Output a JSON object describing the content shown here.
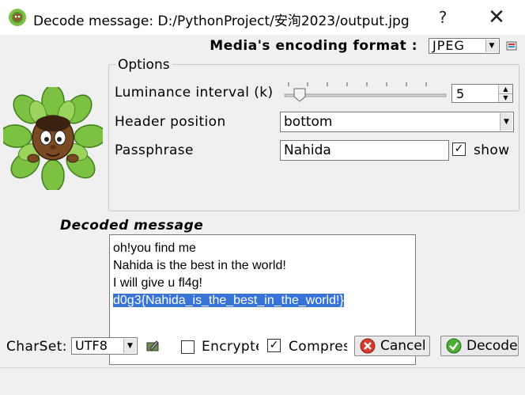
{
  "window": {
    "title": "Decode message: D:/PythonProject/安洵2023/output.jpg",
    "help_label": "?",
    "close_label": "✕"
  },
  "format": {
    "label": "Media's encoding format :",
    "value": "JPEG"
  },
  "options": {
    "legend": "Options",
    "luminance_label": "Luminance interval (k)",
    "luminance_value": "5",
    "header_label": "Header position",
    "header_value": "bottom",
    "passphrase_label": "Passphrase",
    "passphrase_value": "Nahida",
    "show_label": "show",
    "show_checked": true
  },
  "decoded": {
    "label": "Decoded message",
    "lines": [
      "oh!you find me",
      "Nahida is the best in the world!",
      "I will give u fl4g!",
      "d0g3{Nahida_is_the_best_in_the_world!}"
    ],
    "selected_line": 3
  },
  "bottom": {
    "charset_label": "CharSet:",
    "charset_value": "UTF8",
    "encrypted_label": "Encrypted",
    "encrypted_checked": false,
    "compressed_label": "Compressed",
    "compressed_checked": true,
    "cancel_label": "Cancel",
    "decode_label": "Decode"
  },
  "colors": {
    "selection": "#3874d8",
    "cancel_icon": "#d83b2b",
    "decode_icon": "#4caf35"
  }
}
